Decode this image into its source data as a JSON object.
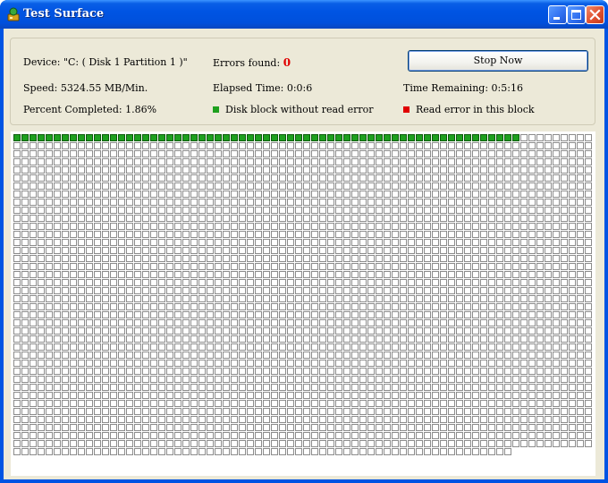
{
  "window": {
    "title": "Test Surface"
  },
  "info": {
    "device_label": "Device:",
    "device_value": "\"C: ( Disk 1 Partition 1 )\"",
    "errors_label": "Errors found:",
    "errors_value": "0",
    "speed_label": "Speed:",
    "speed_value": "5324.55 MB/Min.",
    "elapsed_label": "Elapsed Time:",
    "elapsed_value": "0:0:6",
    "remaining_label": "Time Remaining:",
    "remaining_value": "0:5:16",
    "percent_label": "Percent Completed:",
    "percent_value": "1.86%"
  },
  "legend": {
    "ok_label": "Disk block without read error",
    "error_label": "Read error in this block",
    "ok_color": "#1ea01e",
    "error_color": "#e00000"
  },
  "buttons": {
    "stop_label": "Stop Now"
  },
  "block_map": {
    "columns": 72,
    "rows": 40,
    "last_row_blocks": 62,
    "tested_blocks": 63,
    "error_blocks": 0,
    "untested_color": "#ffffff",
    "ok_color": "#1ea01e"
  }
}
